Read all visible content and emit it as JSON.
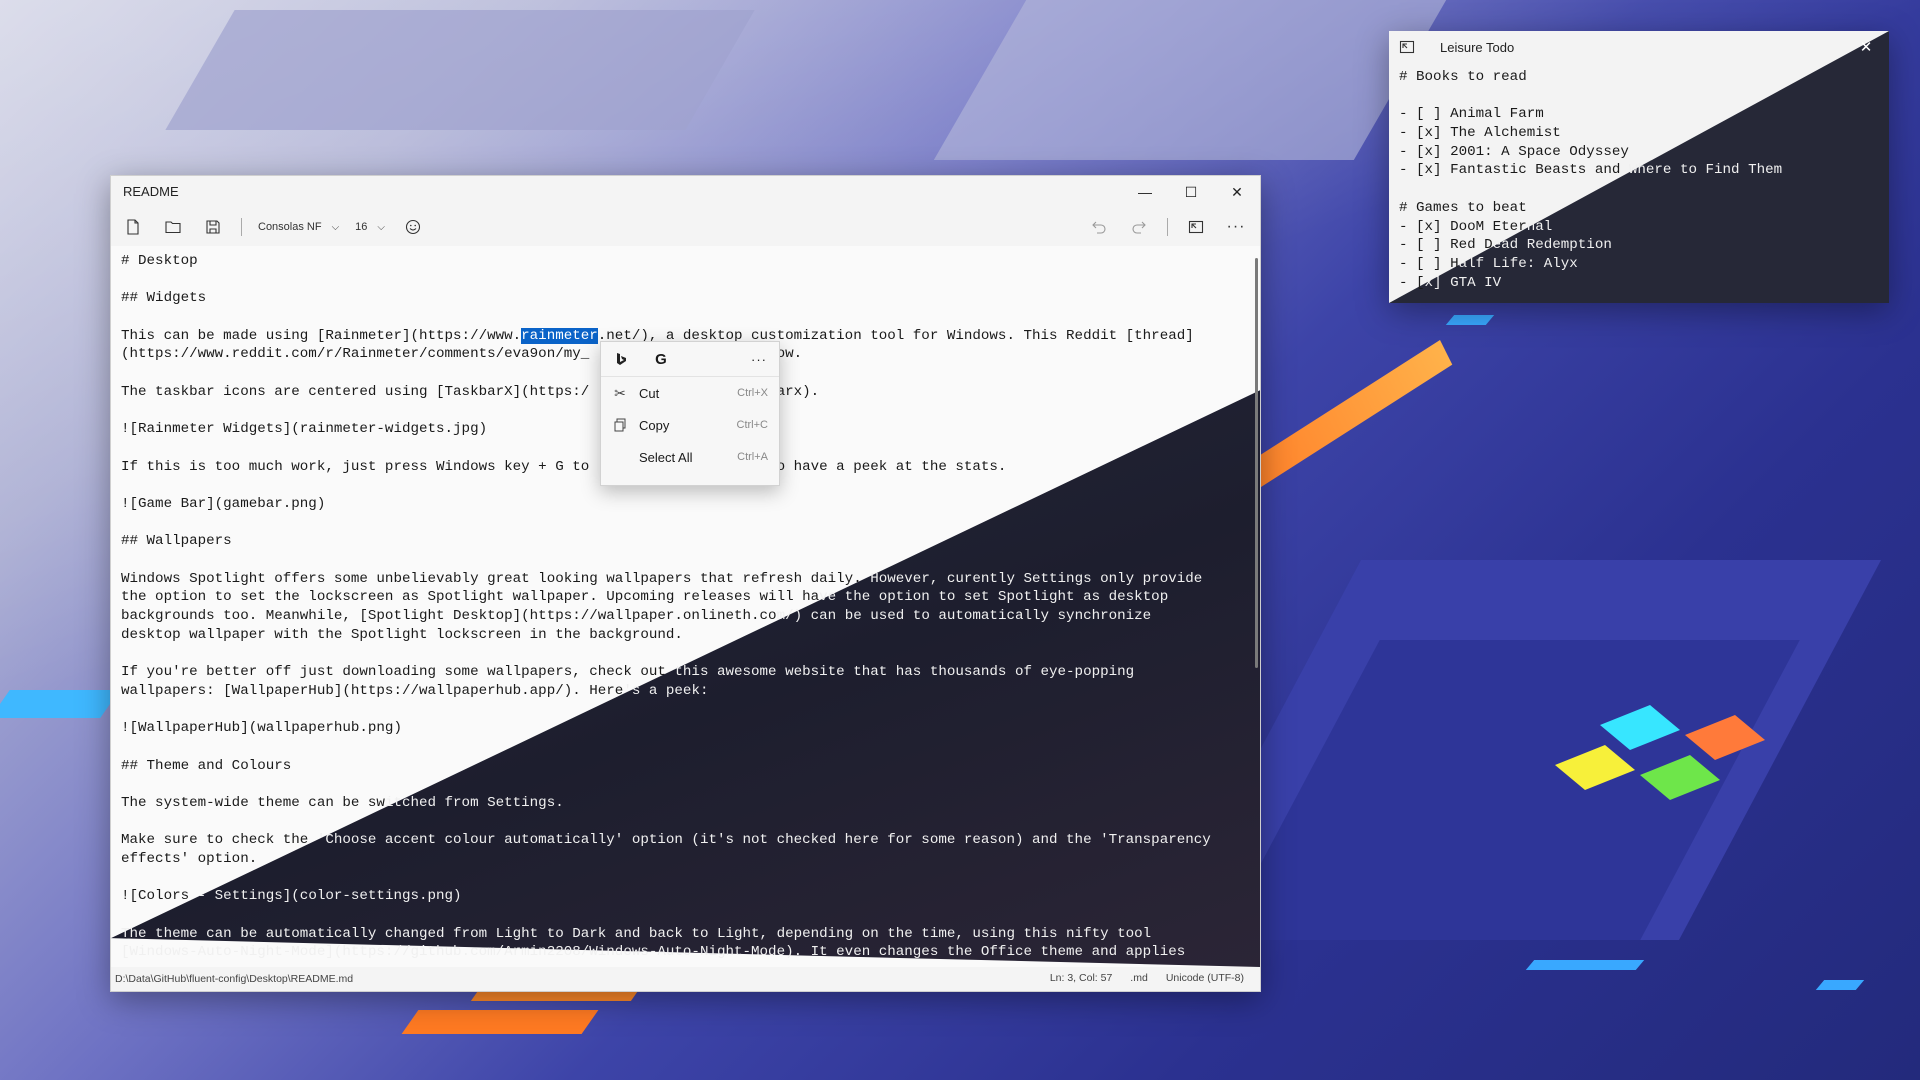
{
  "readme": {
    "title": "README",
    "window_controls": {
      "minimize": "—",
      "maximize": "☐",
      "close": "✕"
    },
    "toolbar": {
      "font": "Consolas NF",
      "size": "16"
    },
    "editor_lines": [
      "# Desktop",
      "",
      "## Widgets",
      "",
      "This can be made using [Rainmeter](https://www.",
      "(https://www.reddit.com/r/Rainmeter/comments/eva9on/my_",
      "",
      "The taskbar icons are centered using [TaskbarX](https:/",
      "",
      "![Rainmeter Widgets](rainmeter-widgets.jpg)",
      "",
      "If this is too much work, just press Windows key + G to",
      "",
      "![Game Bar](gamebar.png)",
      "",
      "## Wallpapers",
      "",
      "Windows Spotlight offers some unbelievably great looking wallpapers that refresh daily. However, curently Settings only provide",
      "the option to set the lockscreen as Spotlight wallpaper. Upcoming releases will have the option to set Spotlight as desktop",
      "backgrounds too. Meanwhile, [Spotlight Desktop](https://wallpaper.onlineth.com/) can be used to automatically synchronize",
      "desktop wallpaper with the Spotlight lockscreen in the background.",
      "",
      "If you're better off just downloading some wallpapers, check out this awesome website that has thousands of eye-popping",
      "wallpapers: [WallpaperHub](https://wallpaperhub.app/). Here's a peek:",
      "",
      "![WallpaperHub](wallpaperhub.png)",
      "",
      "## Theme and Colours",
      "",
      "The system-wide theme can be switched from Settings.",
      "",
      "Make sure to check the 'Choose accent colour automatically' option (it's not checked here for some reason) and the 'Transparency",
      "effects' option.",
      "",
      "![Colors - Settings](color-settings.png)",
      "",
      "The theme can be automatically changed from Light to Dark and back to Light, depending on the time, using this nifty tool",
      "[Windows-Auto-Night-Mode](https://github.com/Armin2208/Windows-Auto-Night-Mode). It even changes the Office theme and applies"
    ],
    "line5_selected": "rainmeter",
    "line5_after": ".net/), a desktop customization tool for Windows. This Reddit [thread]",
    "line6_after": " explains how.",
    "line8_after": "taskbarx).",
    "line12_after": "r to have a peek at the stats.",
    "status": {
      "path": "D:\\Data\\GitHub\\fluent-config\\Desktop\\README.md",
      "position": "Ln: 3, Col: 57",
      "ext": ".md",
      "encoding": "Unicode (UTF-8)"
    }
  },
  "context_menu": {
    "top_icons": {
      "bing": "b",
      "google": "G",
      "more": "···"
    },
    "items": [
      {
        "label": "Cut",
        "accel": "Ctrl+X"
      },
      {
        "label": "Copy",
        "accel": "Ctrl+C"
      },
      {
        "label": "Select All",
        "accel": "Ctrl+A"
      }
    ]
  },
  "todo": {
    "title": "Leisure Todo",
    "lines": [
      "# Books to read",
      "",
      "- [ ] Animal Farm",
      "- [x] The Alchemist",
      "- [x] 2001: A Space Odyssey",
      "- [x] Fantastic Beasts and Where to Find Them",
      "",
      "# Games to beat",
      "- [x] DooM Eternal",
      "- [ ] Red Dead Redemption",
      "- [ ] Half Life: Alyx",
      "- [x] GTA IV"
    ]
  },
  "colors": {
    "selection": "#0a63c8",
    "editor_dark": "#1d1e2e",
    "wallpaper_blue": "#2b3190",
    "accent_orange": "#ff7a22"
  }
}
